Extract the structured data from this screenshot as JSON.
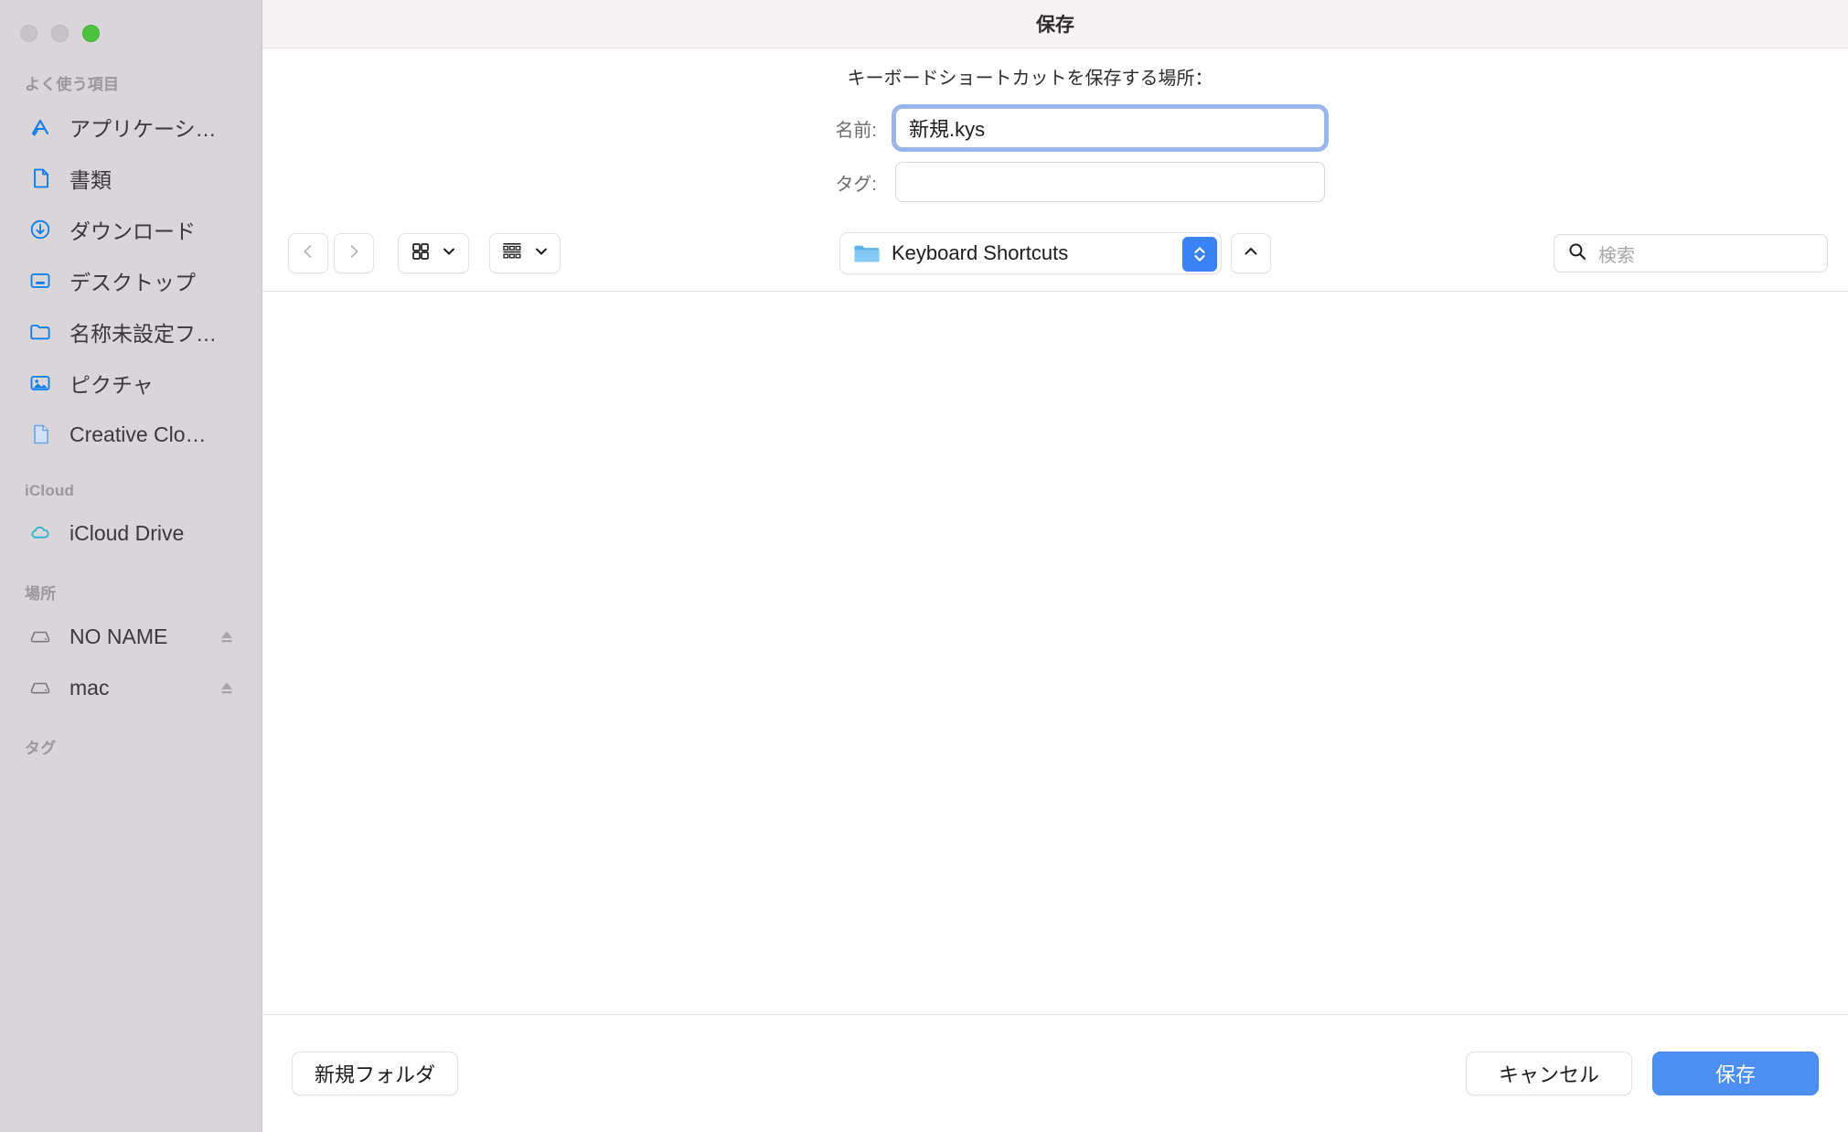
{
  "window": {
    "title": "保存",
    "traffic_lights": [
      "close-button",
      "minimize-button",
      "maximize-button"
    ]
  },
  "sidebar": {
    "groups": [
      {
        "title": "よく使う項目",
        "items": [
          {
            "label": "アプリケーシ…",
            "icon": "applications-icon"
          },
          {
            "label": "書類",
            "icon": "document-icon"
          },
          {
            "label": "ダウンロード",
            "icon": "downloads-icon"
          },
          {
            "label": "デスクトップ",
            "icon": "desktop-icon"
          },
          {
            "label": "名称未設定フ…",
            "icon": "folder-icon"
          },
          {
            "label": "ピクチャ",
            "icon": "pictures-icon"
          },
          {
            "label": "Creative Clo…",
            "icon": "file-icon"
          }
        ]
      },
      {
        "title": "iCloud",
        "items": [
          {
            "label": "iCloud Drive",
            "icon": "cloud-icon"
          }
        ]
      },
      {
        "title": "場所",
        "items": [
          {
            "label": "NO NAME",
            "icon": "disk-icon",
            "eject": "eject-icon"
          },
          {
            "label": "mac",
            "icon": "disk-icon",
            "eject": "eject-icon"
          }
        ]
      },
      {
        "title": "タグ",
        "items": []
      }
    ]
  },
  "header": {
    "prompt": "キーボードショートカットを保存する場所：",
    "name_label": "名前:",
    "name_value": "新規.kys",
    "tag_label": "タグ:",
    "tag_value": "",
    "tag_placeholder": ""
  },
  "toolbar": {
    "back_icon": "chevron-left-icon",
    "forward_icon": "chevron-right-icon",
    "view_icon": "grid-view-icon",
    "view_chevron": "chevron-down-icon",
    "group_icon": "group-by-icon",
    "group_chevron": "chevron-down-icon",
    "path_folder_icon": "blue-folder-icon",
    "path_value": "Keyboard Shortcuts",
    "path_stepper_icon": "up-down-stepper-icon",
    "collapse_icon": "chevron-up-icon",
    "search_icon": "search-icon",
    "search_placeholder": "検索",
    "search_value": ""
  },
  "footer": {
    "new_folder_label": "新規フォルダ",
    "cancel_label": "キャンセル",
    "save_label": "保存"
  },
  "colors": {
    "accent": "#4d8ef2",
    "sidebar_bg": "#d9d6d9",
    "titlebar_bg": "#f7f3f5",
    "focus_ring": "#789be8",
    "icon_blue": "#0a7cf0",
    "maximize_green": "#4cc13d"
  }
}
